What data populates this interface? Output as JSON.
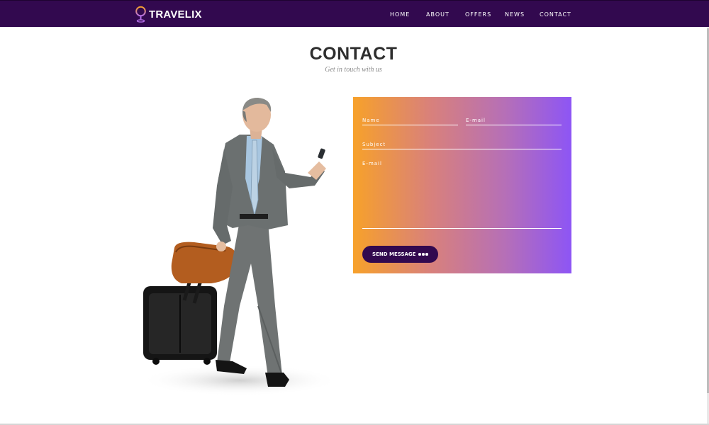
{
  "header": {
    "logo_text": "TRAVELIX",
    "nav": [
      "HOME",
      "ABOUT",
      "OFFERS",
      "NEWS",
      "CONTACT"
    ]
  },
  "section": {
    "title": "CONTACT",
    "subtitle": "Get in touch with us"
  },
  "form": {
    "name_placeholder": "Name",
    "email_placeholder": "E-mail",
    "subject_placeholder": "Subject",
    "message_placeholder": "E-mail",
    "send_label": "SEND MESSAGE"
  },
  "colors": {
    "header_bg": "#32094f",
    "gradient_start": "#f7a12a",
    "gradient_end": "#8d55f5",
    "button_bg": "#32094f"
  },
  "icons": {
    "logo": "map-pin-icon",
    "button": "dots-icon"
  }
}
